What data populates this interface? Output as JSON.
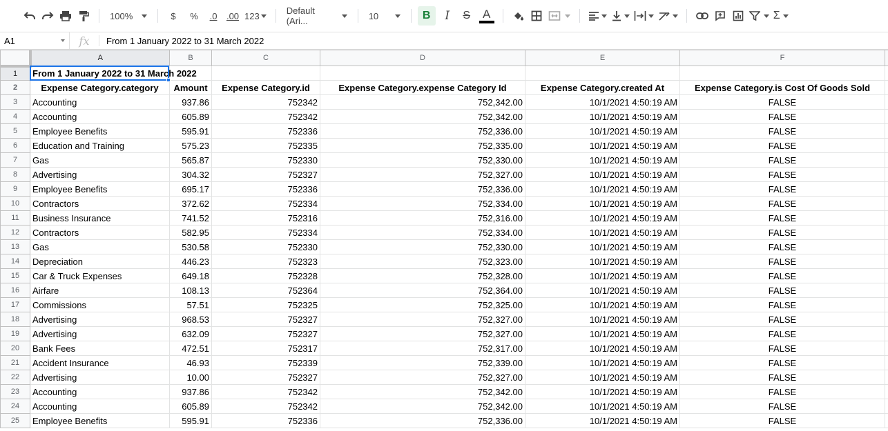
{
  "toolbar": {
    "zoom": "100%",
    "currency": "$",
    "percent": "%",
    "decrease_decimals": ".0",
    "increase_decimals": ".00",
    "more_formats": "123",
    "font": "Default (Ari...",
    "font_size": "10",
    "bold": "B",
    "italic": "I",
    "strikethrough": "S",
    "text_color": "A"
  },
  "formula_bar": {
    "cell_ref": "A1",
    "fx": "fx",
    "value": "From 1 January 2022 to 31 March 2022"
  },
  "columns": [
    "A",
    "B",
    "C",
    "D",
    "E",
    "F"
  ],
  "title": "From 1 January 2022 to 31 March 2022",
  "headers": [
    "Expense Category.category",
    "Amount",
    "Expense Category.id",
    "Expense Category.expense Category Id",
    "Expense Category.created At",
    "Expense Category.is Cost Of Goods Sold"
  ],
  "rows": [
    [
      "Accounting",
      "937.86",
      "752342",
      "752,342.00",
      "10/1/2021 4:50:19 AM",
      "FALSE"
    ],
    [
      "Accounting",
      "605.89",
      "752342",
      "752,342.00",
      "10/1/2021 4:50:19 AM",
      "FALSE"
    ],
    [
      "Employee Benefits",
      "595.91",
      "752336",
      "752,336.00",
      "10/1/2021 4:50:19 AM",
      "FALSE"
    ],
    [
      "Education and Training",
      "575.23",
      "752335",
      "752,335.00",
      "10/1/2021 4:50:19 AM",
      "FALSE"
    ],
    [
      "Gas",
      "565.87",
      "752330",
      "752,330.00",
      "10/1/2021 4:50:19 AM",
      "FALSE"
    ],
    [
      "Advertising",
      "304.32",
      "752327",
      "752,327.00",
      "10/1/2021 4:50:19 AM",
      "FALSE"
    ],
    [
      "Employee Benefits",
      "695.17",
      "752336",
      "752,336.00",
      "10/1/2021 4:50:19 AM",
      "FALSE"
    ],
    [
      "Contractors",
      "372.62",
      "752334",
      "752,334.00",
      "10/1/2021 4:50:19 AM",
      "FALSE"
    ],
    [
      "Business Insurance",
      "741.52",
      "752316",
      "752,316.00",
      "10/1/2021 4:50:19 AM",
      "FALSE"
    ],
    [
      "Contractors",
      "582.95",
      "752334",
      "752,334.00",
      "10/1/2021 4:50:19 AM",
      "FALSE"
    ],
    [
      "Gas",
      "530.58",
      "752330",
      "752,330.00",
      "10/1/2021 4:50:19 AM",
      "FALSE"
    ],
    [
      "Depreciation",
      "446.23",
      "752323",
      "752,323.00",
      "10/1/2021 4:50:19 AM",
      "FALSE"
    ],
    [
      "Car & Truck Expenses",
      "649.18",
      "752328",
      "752,328.00",
      "10/1/2021 4:50:19 AM",
      "FALSE"
    ],
    [
      "Airfare",
      "108.13",
      "752364",
      "752,364.00",
      "10/1/2021 4:50:19 AM",
      "FALSE"
    ],
    [
      "Commissions",
      "57.51",
      "752325",
      "752,325.00",
      "10/1/2021 4:50:19 AM",
      "FALSE"
    ],
    [
      "Advertising",
      "968.53",
      "752327",
      "752,327.00",
      "10/1/2021 4:50:19 AM",
      "FALSE"
    ],
    [
      "Advertising",
      "632.09",
      "752327",
      "752,327.00",
      "10/1/2021 4:50:19 AM",
      "FALSE"
    ],
    [
      "Bank Fees",
      "472.51",
      "752317",
      "752,317.00",
      "10/1/2021 4:50:19 AM",
      "FALSE"
    ],
    [
      "Accident Insurance",
      "46.93",
      "752339",
      "752,339.00",
      "10/1/2021 4:50:19 AM",
      "FALSE"
    ],
    [
      "Advertising",
      "10.00",
      "752327",
      "752,327.00",
      "10/1/2021 4:50:19 AM",
      "FALSE"
    ],
    [
      "Accounting",
      "937.86",
      "752342",
      "752,342.00",
      "10/1/2021 4:50:19 AM",
      "FALSE"
    ],
    [
      "Accounting",
      "605.89",
      "752342",
      "752,342.00",
      "10/1/2021 4:50:19 AM",
      "FALSE"
    ],
    [
      "Employee Benefits",
      "595.91",
      "752336",
      "752,336.00",
      "10/1/2021 4:50:19 AM",
      "FALSE"
    ]
  ],
  "colors": {
    "selection": "#1a73e8",
    "bold_active_bg": "#e6f4ea",
    "bold_active_fg": "#188038"
  }
}
